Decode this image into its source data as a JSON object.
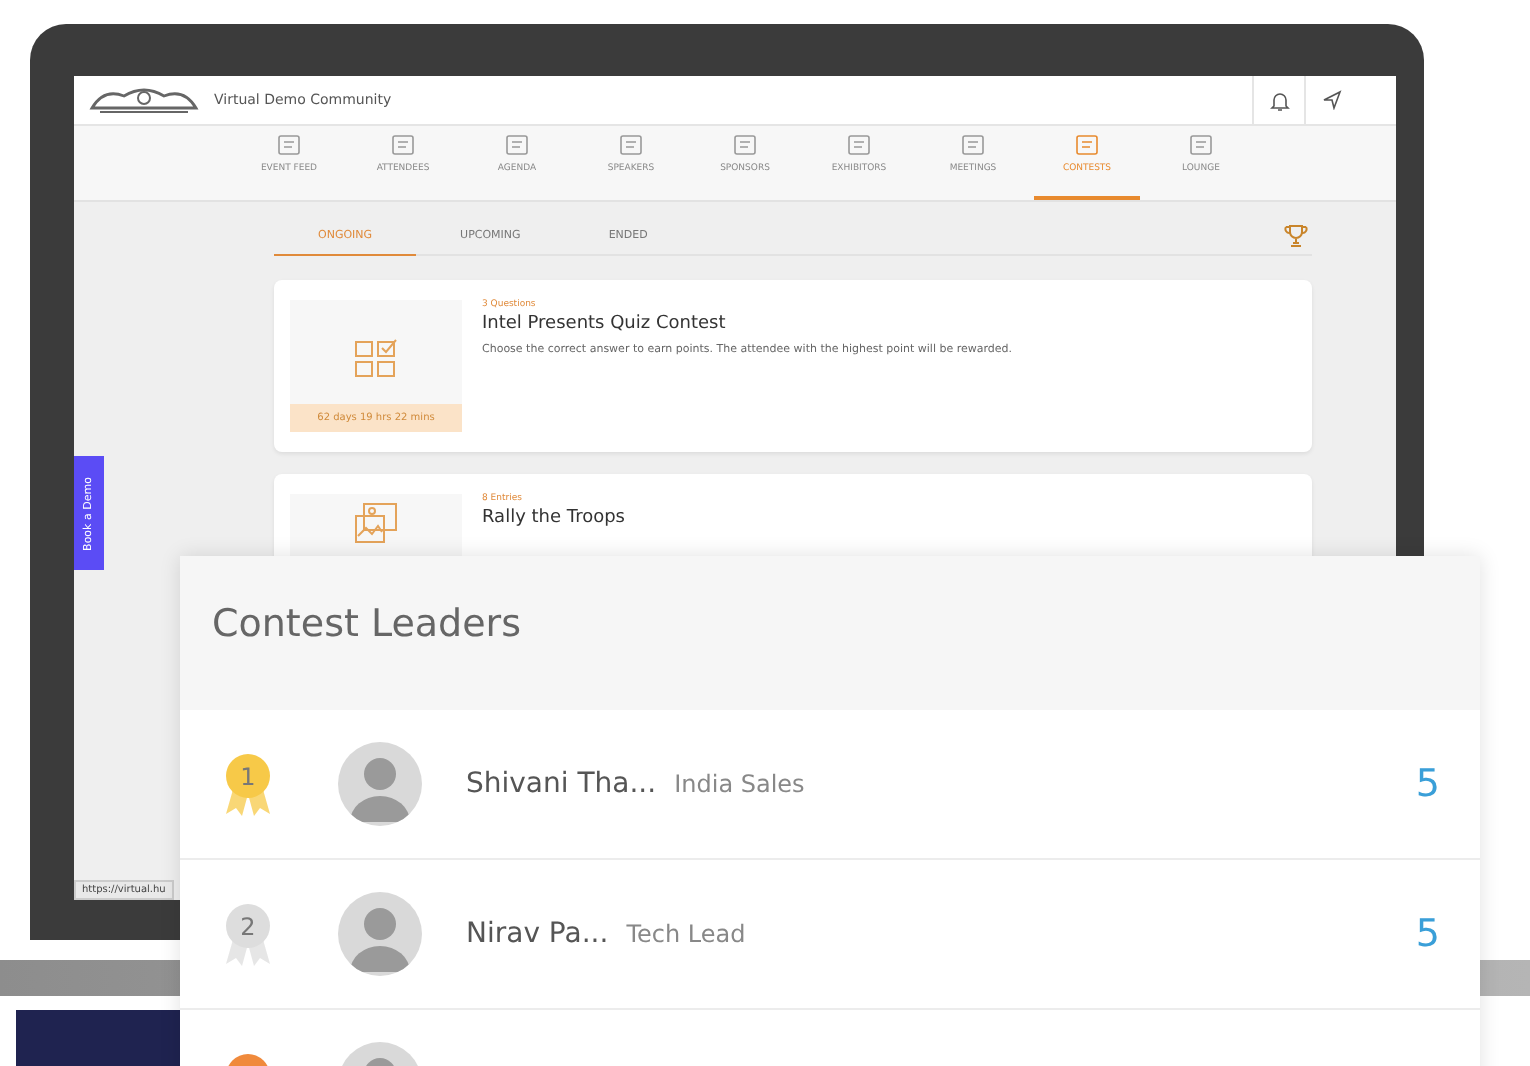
{
  "header": {
    "community_name": "Virtual Demo Community"
  },
  "nav": [
    {
      "label": "EVENT FEED",
      "selected": false
    },
    {
      "label": "ATTENDEES",
      "selected": false
    },
    {
      "label": "AGENDA",
      "selected": false
    },
    {
      "label": "SPEAKERS",
      "selected": false
    },
    {
      "label": "SPONSORS",
      "selected": false
    },
    {
      "label": "EXHIBITORS",
      "selected": false
    },
    {
      "label": "MEETINGS",
      "selected": false
    },
    {
      "label": "CONTESTS",
      "selected": true
    },
    {
      "label": "LOUNGE",
      "selected": false
    }
  ],
  "tabs": [
    {
      "label": "ONGOING",
      "selected": true
    },
    {
      "label": "UPCOMING",
      "selected": false
    },
    {
      "label": "ENDED",
      "selected": false
    }
  ],
  "contests": [
    {
      "kind": "quiz",
      "meta": "3 Questions",
      "title": "Intel Presents Quiz Contest",
      "description": "Choose the correct answer to earn points. The attendee with the highest point will be rewarded.",
      "timer": "62 days 19 hrs 22 mins"
    },
    {
      "kind": "photo",
      "meta": "8 Entries",
      "title": "Rally the Troops"
    }
  ],
  "book_demo": "Book a Demo",
  "status_url": "https://virtual.hu",
  "leaders": {
    "title": "Contest Leaders",
    "rows": [
      {
        "color": "#f7c948",
        "rank": "1",
        "name": "Shivani Tha...",
        "team": "India Sales",
        "score": "5"
      },
      {
        "color": "#dddddd",
        "rank": "2",
        "name": "Nirav Pa...",
        "team": "Tech Lead",
        "score": "5"
      },
      {
        "color": "#f08a3c"
      }
    ]
  }
}
